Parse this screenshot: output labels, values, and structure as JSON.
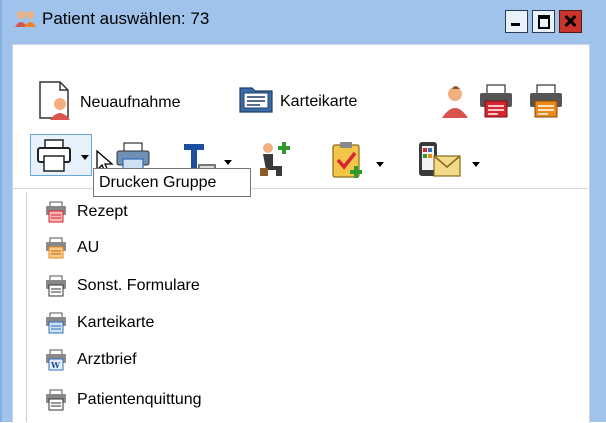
{
  "window": {
    "title": "Patient auswählen: 73"
  },
  "toolbar_row1": {
    "neuaufnahme_label": "Neuaufnahme",
    "karteikarte_label": "Karteikarte"
  },
  "tooltip": {
    "text": "Drucken Gruppe"
  },
  "menu": {
    "items": [
      {
        "label": "Rezept",
        "icon": "rezept-printer-icon"
      },
      {
        "label": "AU",
        "icon": "au-printer-icon"
      },
      {
        "label": "Sonst. Formulare",
        "icon": "forms-printer-icon"
      },
      {
        "label": "Karteikarte",
        "icon": "karteikarte-printer-icon"
      },
      {
        "label": "Arztbrief",
        "icon": "arztbrief-printer-icon"
      },
      {
        "label": "Patientenquittung",
        "icon": "quittung-printer-icon"
      }
    ]
  },
  "colors": {
    "titlebar": "#9fc3ea",
    "close": "#c9352b",
    "print_red": "#d7262e",
    "print_orange": "#e88a1a",
    "accent_blue": "#2f6fb8",
    "green": "#2e9b2e"
  }
}
